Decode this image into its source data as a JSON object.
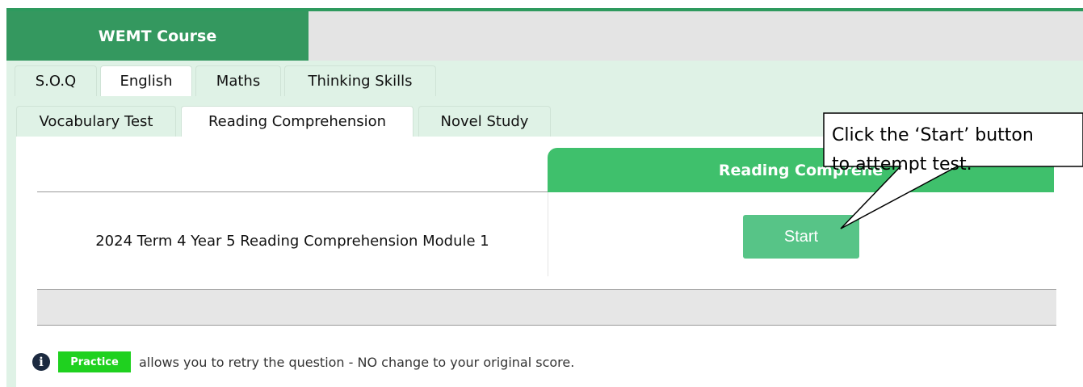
{
  "course": {
    "title": "WEMT Course"
  },
  "subject_tabs": [
    {
      "label": "S.O.Q",
      "active": false
    },
    {
      "label": "English",
      "active": true
    },
    {
      "label": "Maths",
      "active": false
    },
    {
      "label": "Thinking Skills",
      "active": false
    }
  ],
  "english_tabs": [
    {
      "label": "Vocabulary Test",
      "active": false
    },
    {
      "label": "Reading Comprehension",
      "active": true
    },
    {
      "label": "Novel Study",
      "active": false
    }
  ],
  "table": {
    "column_header": "Reading Comprehe",
    "rows": [
      {
        "module": "2024 Term 4 Year 5 Reading Comprehension Module 1",
        "action_label": "Start"
      }
    ]
  },
  "info": {
    "badge": "Practice",
    "text": "allows you to retry the question - NO change to your original score."
  },
  "callout": {
    "line1": "Click the ‘Start’ button",
    "line2": "to attempt test."
  },
  "colors": {
    "course_tab": "#34985f",
    "panel_bg": "#dff2e6",
    "table_header": "#3fc06c",
    "start_button": "#57c487",
    "practice_badge": "#1fd11f"
  }
}
